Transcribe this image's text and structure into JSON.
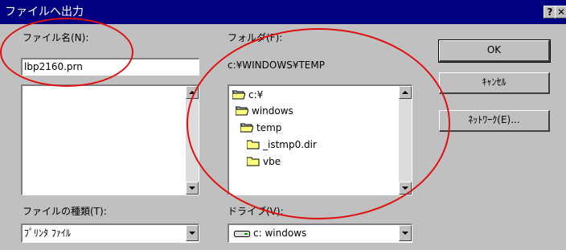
{
  "window": {
    "title": "ファイルへ出力",
    "help_glyph": "?",
    "close_glyph": "✕"
  },
  "filename": {
    "label": "ファイル名(N):",
    "value": "lbp2160.prn"
  },
  "folder": {
    "label": "フォルダ(F):",
    "path": "c:¥WINDOWS¥TEMP",
    "tree": [
      {
        "label": "c:¥",
        "icon": "open-folder-icon"
      },
      {
        "label": "windows",
        "icon": "open-folder-icon"
      },
      {
        "label": "temp",
        "icon": "open-folder-icon"
      },
      {
        "label": "_istmp0.dir",
        "icon": "folder-icon"
      },
      {
        "label": "vbe",
        "icon": "folder-icon"
      }
    ]
  },
  "filetype": {
    "label": "ファイルの種類(T):",
    "value": "ﾌﾟﾘﾝﾀ ﾌｧｲﾙ"
  },
  "drive": {
    "label": "ドライブ(V):",
    "value": "c: windows",
    "icon": "drive-icon"
  },
  "buttons": {
    "ok": "OK",
    "cancel": "ｷｬﾝｾﾙ",
    "network": "ﾈｯﾄﾜｰｸ(E)..."
  },
  "colors": {
    "titlebar": "#000080",
    "face": "#c0c0c0",
    "annotation": "#e01010"
  }
}
